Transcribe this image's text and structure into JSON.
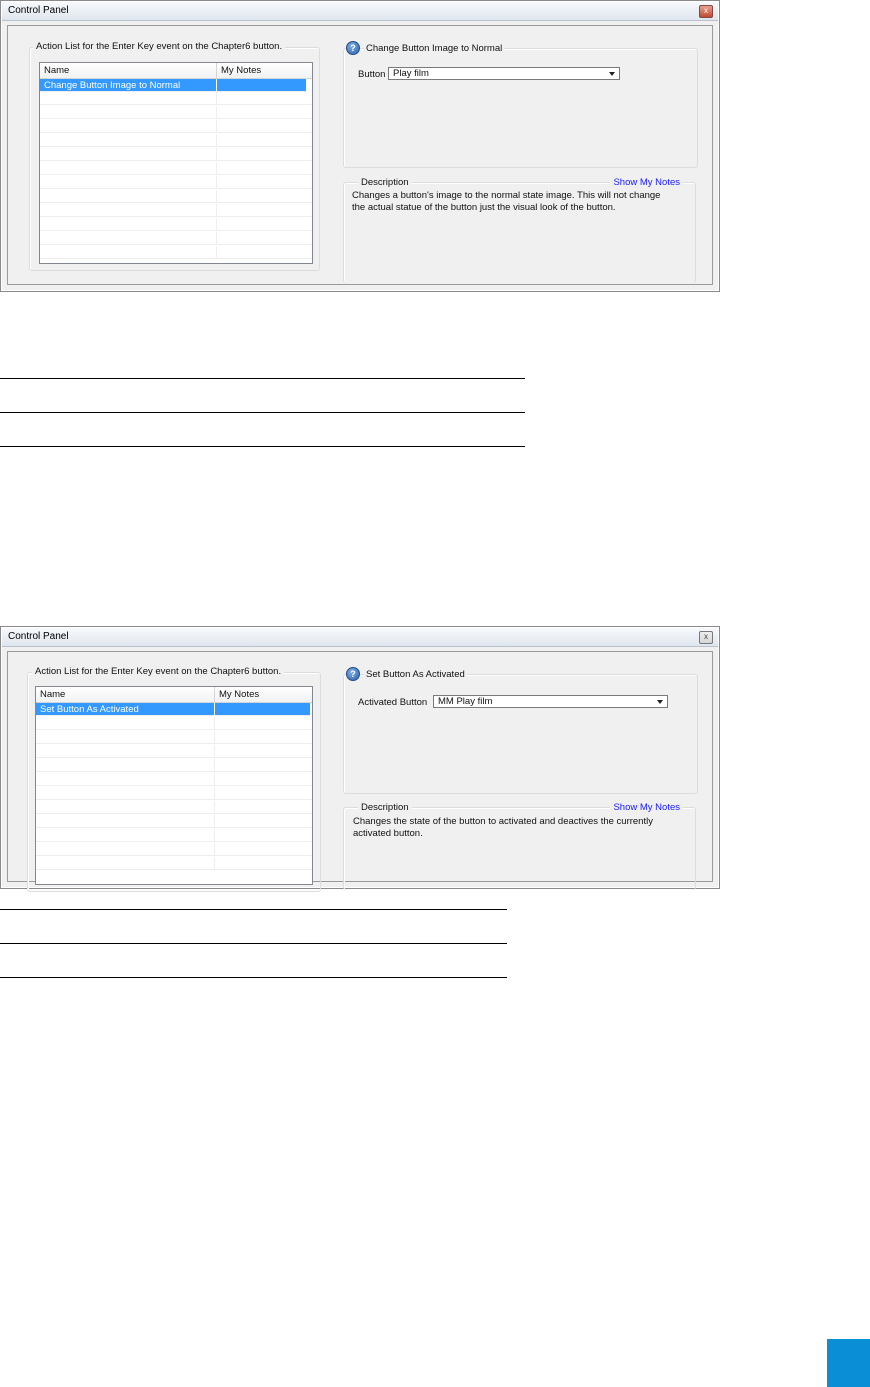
{
  "panel1": {
    "title": "Control Panel",
    "close_glyph": "x",
    "action_list_legend": "Action List for the Enter Key event on the Chapter6 button.",
    "list_columns": [
      "Name",
      "My Notes"
    ],
    "list_rows": [
      "Change Button Image to Normal"
    ],
    "action_title": "Change Button Image to Normal",
    "field_label": "Button",
    "field_value": "Play film",
    "description_label": "Description",
    "show_notes": "Show My Notes",
    "description_text": "Changes a button's image to the normal state image.  This will not change the actual statue of the button just the visual look of the button."
  },
  "panel2": {
    "title": "Control Panel",
    "close_glyph": "x",
    "action_list_legend": "Action List for the Enter Key event on the Chapter6 button.",
    "list_columns": [
      "Name",
      "My Notes"
    ],
    "list_rows": [
      "Set Button As Activated"
    ],
    "action_title": "Set Button As Activated",
    "field_label": "Activated Button",
    "field_value": "MM Play film",
    "description_label": "Description",
    "show_notes": "Show My Notes",
    "description_text": "Changes the state of the button to activated and deactives the currently activated button."
  },
  "icons": {
    "help": "help-icon",
    "close": "close-icon",
    "dropdown": "chevron-down-icon"
  },
  "colors": {
    "selection": "#3399ff",
    "link": "#1a1aff",
    "page_accent": "#0a8fd6"
  }
}
